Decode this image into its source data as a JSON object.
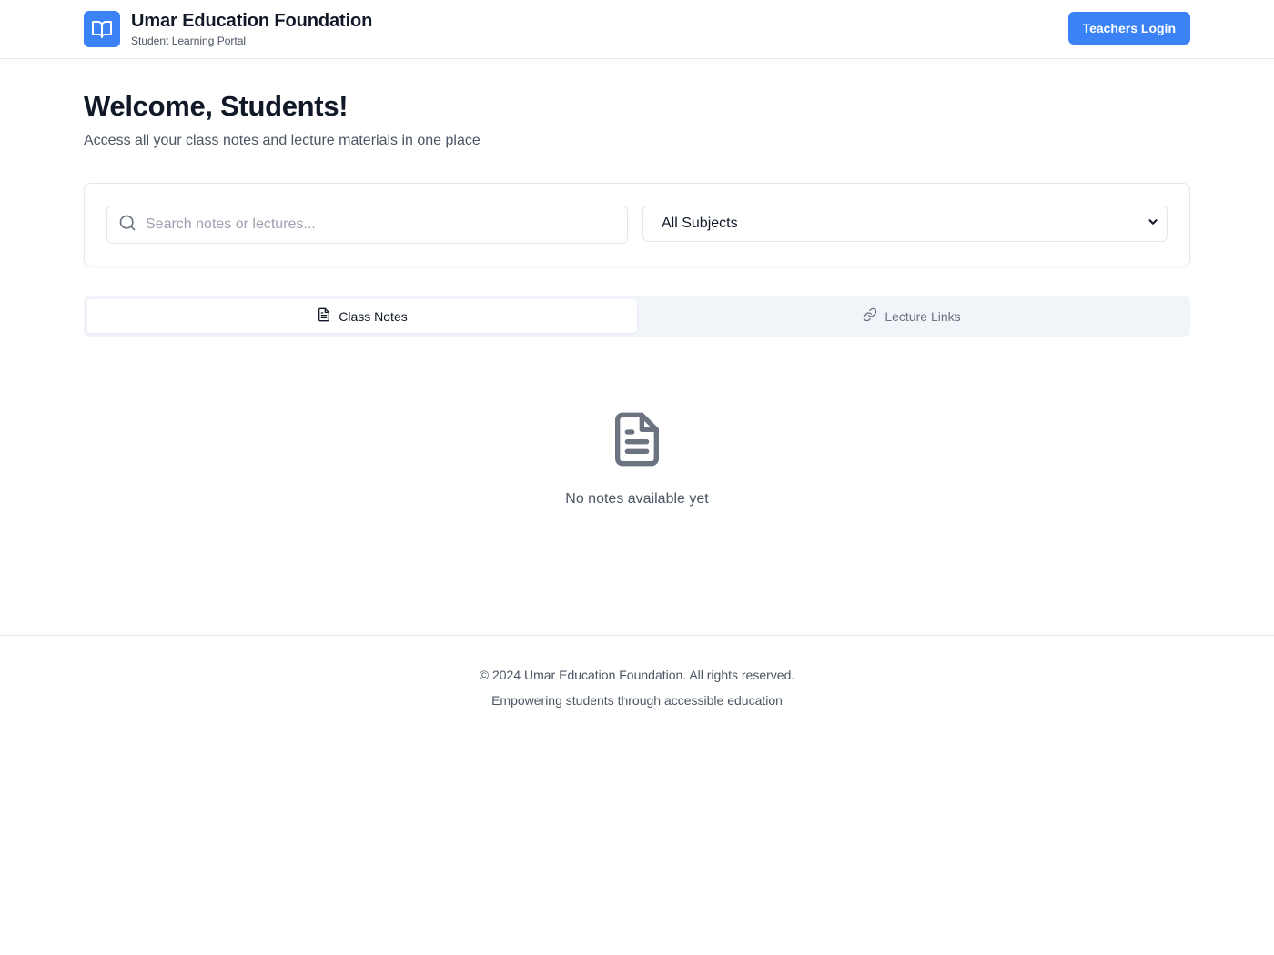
{
  "header": {
    "title": "Umar Education Foundation",
    "subtitle": "Student Learning Portal",
    "login_label": "Teachers Login",
    "logo_icon": "book-open-icon"
  },
  "hero": {
    "title": "Welcome, Students!",
    "subtitle": "Access all your class notes and lecture materials in one place"
  },
  "filters": {
    "search_placeholder": "Search notes or lectures...",
    "search_value": "",
    "subject_selected": "All Subjects"
  },
  "tabs": [
    {
      "label": "Class Notes",
      "icon": "file-text-icon",
      "active": true
    },
    {
      "label": "Lecture Links",
      "icon": "link-icon",
      "active": false
    }
  ],
  "empty_state": {
    "icon": "file-text-icon",
    "message": "No notes available yet"
  },
  "footer": {
    "copyright": "© 2024 Umar Education Foundation. All rights reserved.",
    "tagline": "Empowering students through accessible education"
  },
  "colors": {
    "primary": "#3b82f6",
    "text": "#111827",
    "muted": "#4b5563",
    "border": "#e5e7eb",
    "tab_bg": "#f1f5f9"
  }
}
